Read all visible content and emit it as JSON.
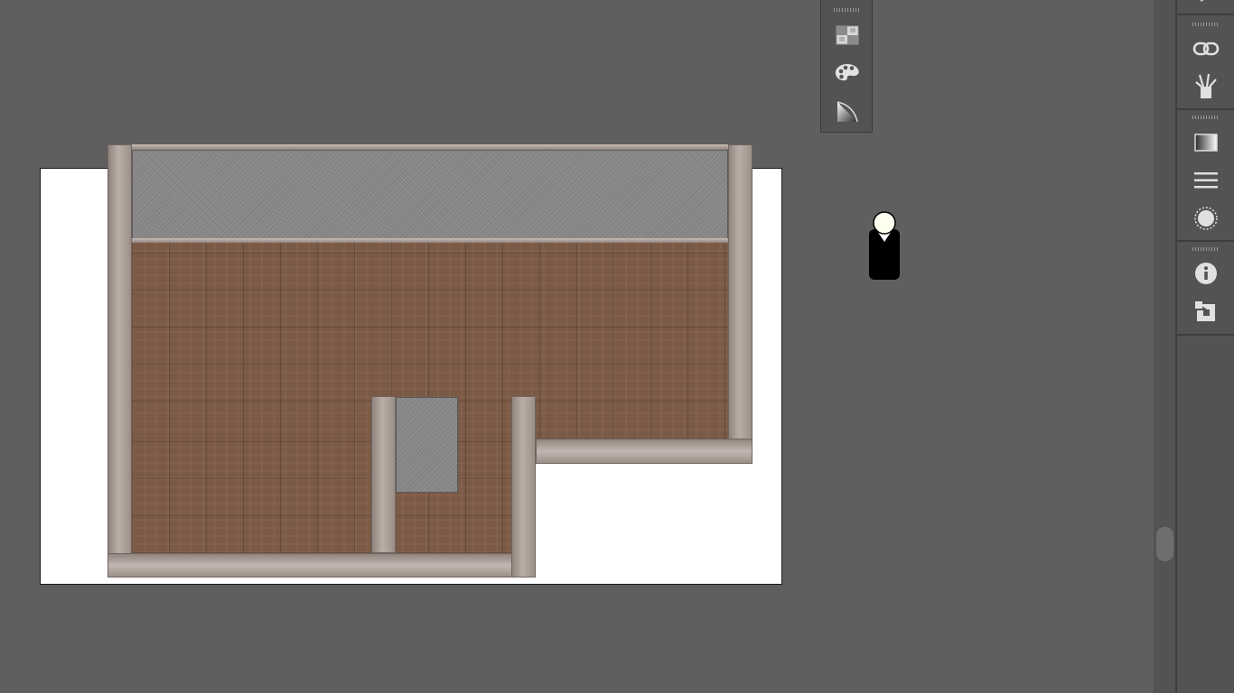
{
  "app": {
    "canvas": {
      "background": "#5f5f5f",
      "artboard_color": "#ffffff"
    }
  },
  "floorplan": {
    "materials": {
      "wood_floor": "wood-plank-texture",
      "stone_floor": "granite-texture",
      "wall": "plaster-wall"
    },
    "accent_colors": {
      "wood": "#7a5a47",
      "stone": "#8a8a8a",
      "wall": "#b9aea7"
    }
  },
  "floating_panel": {
    "tools": [
      {
        "icon": "grid-pattern-icon"
      },
      {
        "icon": "palette-icon"
      },
      {
        "icon": "gradient-triangle-icon"
      }
    ]
  },
  "person_marker": {
    "icon": "person-scale-icon"
  },
  "dock": {
    "groups": [
      {
        "items": [
          {
            "icon": "link-icon"
          },
          {
            "icon": "brushes-icon"
          }
        ]
      },
      {
        "items": [
          {
            "icon": "gradient-swatch-icon"
          },
          {
            "icon": "stroke-lines-icon"
          },
          {
            "icon": "appearance-circle-icon"
          }
        ]
      },
      {
        "items": [
          {
            "icon": "info-icon"
          },
          {
            "icon": "export-asset-icon"
          }
        ]
      }
    ]
  },
  "scrollbar": {
    "position_fraction": 0.78
  }
}
